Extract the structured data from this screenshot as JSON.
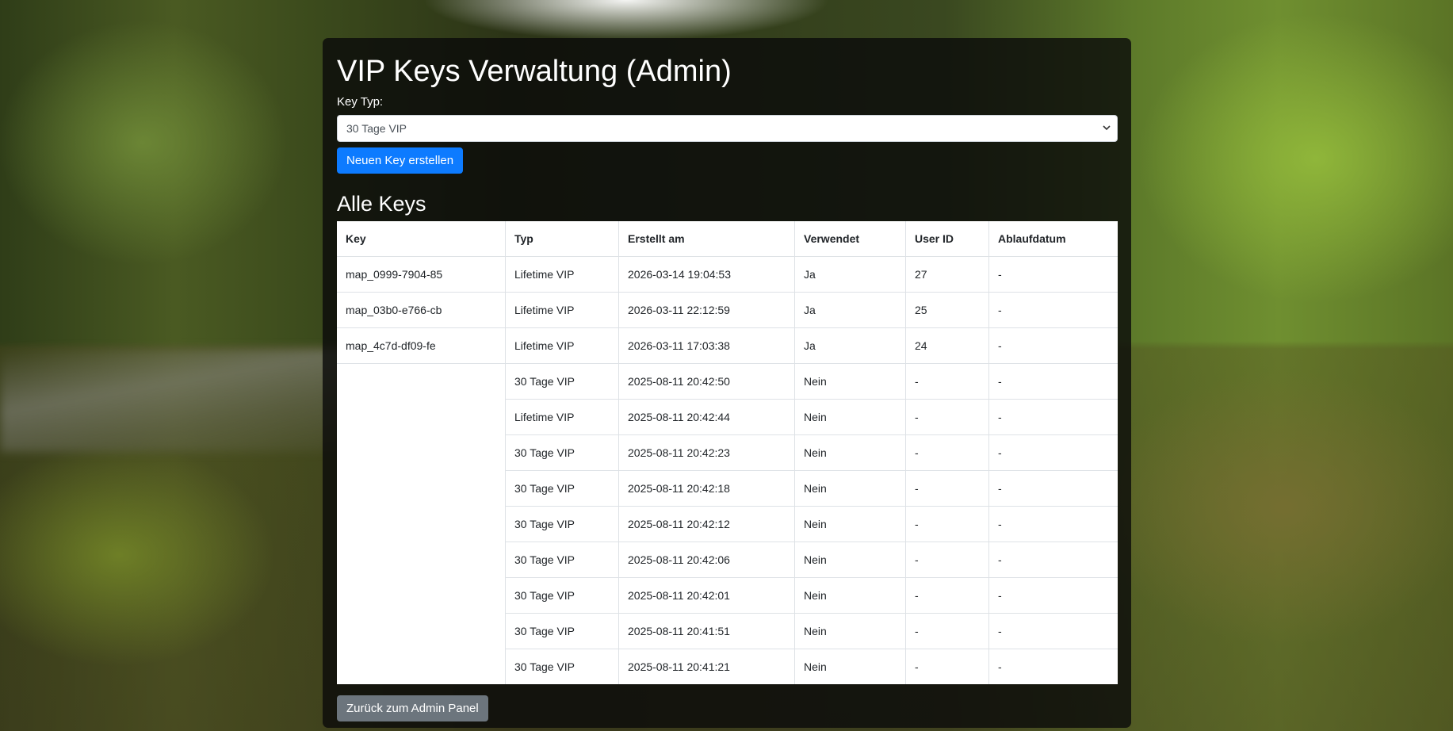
{
  "page": {
    "title": "VIP Keys Verwaltung (Admin)",
    "key_type_label": "Key Typ:",
    "key_type_selected": "30 Tage VIP",
    "create_button": "Neuen Key erstellen",
    "all_keys_heading": "Alle Keys",
    "back_button": "Zurück zum Admin Panel"
  },
  "table": {
    "headers": [
      "Key",
      "Typ",
      "Erstellt am",
      "Verwendet",
      "User ID",
      "Ablaufdatum"
    ],
    "rows": [
      [
        "map_0999-7904-85",
        "Lifetime VIP",
        "2026-03-14 19:04:53",
        "Ja",
        "27",
        "-"
      ],
      [
        "map_03b0-e766-cb",
        "Lifetime VIP",
        "2026-03-11 22:12:59",
        "Ja",
        "25",
        "-"
      ],
      [
        "map_4c7d-df09-fe",
        "Lifetime VIP",
        "2026-03-11 17:03:38",
        "Ja",
        "24",
        "-"
      ],
      [
        "",
        "30 Tage VIP",
        "2025-08-11 20:42:50",
        "Nein",
        "-",
        "-"
      ],
      [
        "",
        "Lifetime VIP",
        "2025-08-11 20:42:44",
        "Nein",
        "-",
        "-"
      ],
      [
        "",
        "30 Tage VIP",
        "2025-08-11 20:42:23",
        "Nein",
        "-",
        "-"
      ],
      [
        "",
        "30 Tage VIP",
        "2025-08-11 20:42:18",
        "Nein",
        "-",
        "-"
      ],
      [
        "",
        "30 Tage VIP",
        "2025-08-11 20:42:12",
        "Nein",
        "-",
        "-"
      ],
      [
        "",
        "30 Tage VIP",
        "2025-08-11 20:42:06",
        "Nein",
        "-",
        "-"
      ],
      [
        "",
        "30 Tage VIP",
        "2025-08-11 20:42:01",
        "Nein",
        "-",
        "-"
      ],
      [
        "",
        "30 Tage VIP",
        "2025-08-11 20:41:51",
        "Nein",
        "-",
        "-"
      ],
      [
        "",
        "30 Tage VIP",
        "2025-08-11 20:41:21",
        "Nein",
        "-",
        "-"
      ]
    ]
  },
  "colors": {
    "primary": "#0d7bff",
    "secondary": "#6c757d",
    "panel": "rgba(10,10,10,0.80)"
  },
  "icons": {
    "select_chevron": "chevron-down-icon"
  }
}
